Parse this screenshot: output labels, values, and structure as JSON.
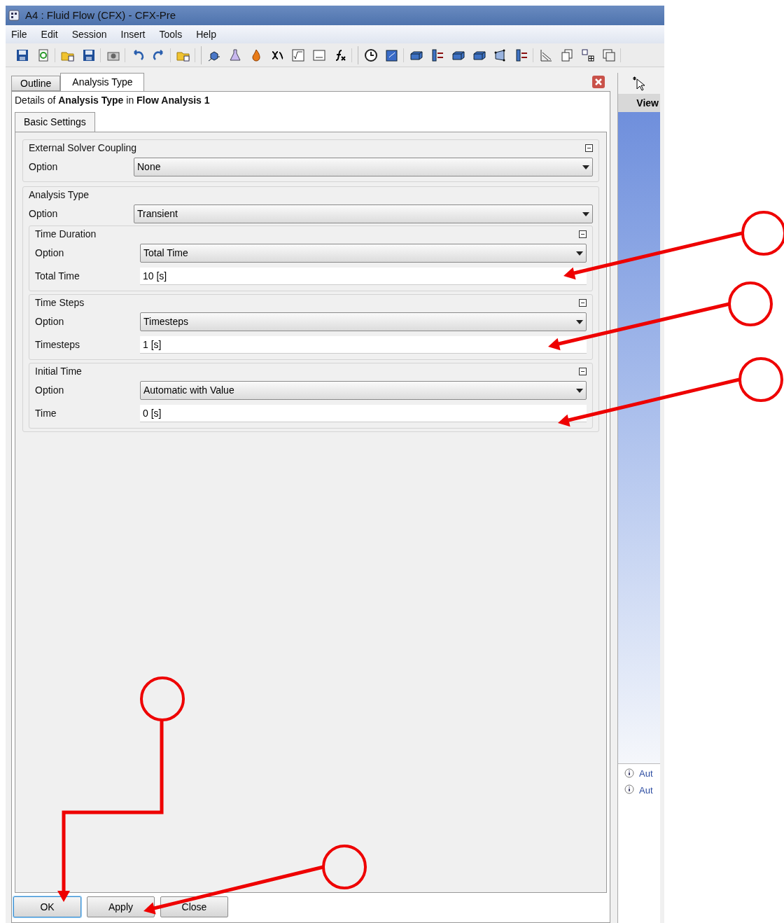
{
  "window": {
    "title": "A4 : Fluid Flow (CFX) - CFX-Pre"
  },
  "menu": [
    "File",
    "Edit",
    "Session",
    "Insert",
    "Tools",
    "Help"
  ],
  "tabs": [
    {
      "label": "Outline",
      "selected": false
    },
    {
      "label": "Analysis Type",
      "selected": true
    }
  ],
  "details": "Details of **Analysis Type** in **Flow Analysis 1**",
  "subtabs": [
    {
      "label": "Basic Settings",
      "selected": true
    }
  ],
  "sections": [
    {
      "title": "External Solver Coupling",
      "collapsible": true,
      "rows": [
        {
          "label": "Option",
          "kind": "dropdown",
          "value": "None"
        }
      ]
    },
    {
      "title": "Analysis Type",
      "collapsible": false,
      "rows": [
        {
          "label": "Option",
          "kind": "dropdown",
          "value": "Transient"
        }
      ],
      "groups": [
        {
          "title": "Time Duration",
          "rows": [
            {
              "label": "Option",
              "kind": "dropdown",
              "value": "Total Time"
            },
            {
              "label": "Total Time",
              "kind": "text",
              "value": "10 [s]"
            }
          ]
        },
        {
          "title": "Time Steps",
          "rows": [
            {
              "label": "Option",
              "kind": "dropdown",
              "value": "Timesteps"
            },
            {
              "label": "Timesteps",
              "kind": "text",
              "value": "1 [s]"
            }
          ]
        },
        {
          "title": "Initial Time",
          "rows": [
            {
              "label": "Option",
              "kind": "dropdown",
              "value": "Automatic with Value"
            },
            {
              "label": "Time",
              "kind": "text",
              "value": "0 [s]"
            }
          ]
        }
      ]
    }
  ],
  "buttons": [
    {
      "label": "OK",
      "default": true
    },
    {
      "label": "Apply",
      "default": false
    },
    {
      "label": "Close",
      "default": false
    }
  ],
  "viewer": {
    "title": "View",
    "messages": [
      "Aut",
      "Aut"
    ]
  }
}
